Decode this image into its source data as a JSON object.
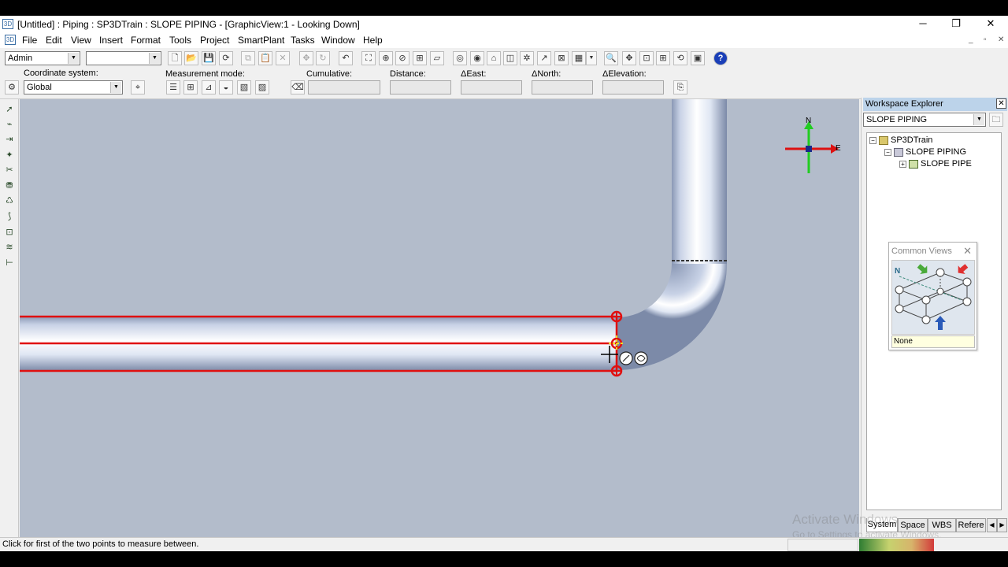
{
  "window": {
    "app_icon": "3D",
    "title": "[Untitled] : Piping : SP3DTrain : SLOPE PIPING - [GraphicView:1 - Looking Down]",
    "minimize": "─",
    "restore": "❐",
    "close": "✕"
  },
  "menu": {
    "doc_icon": "3D",
    "items": [
      "File",
      "Edit",
      "View",
      "Insert",
      "Format",
      "Tools",
      "Project",
      "SmartPlant",
      "Tasks",
      "Window",
      "Help"
    ],
    "mdi_min": "_",
    "mdi_restore": "▫",
    "mdi_close": "✕"
  },
  "toolbar1": {
    "permission_value": "Admin",
    "filter_value": ""
  },
  "measure_bar": {
    "coord_label": "Coordinate system:",
    "coord_value": "Global",
    "mode_label": "Measurement mode:",
    "cumulative_label": "Cumulative:",
    "distance_label": "Distance:",
    "east_label": "ΔEast:",
    "north_label": "ΔNorth:",
    "elevation_label": "ΔElevation:",
    "cumulative_value": "",
    "distance_value": "",
    "east_value": "",
    "north_value": "",
    "elevation_value": ""
  },
  "compass": {
    "north": "N",
    "east": "E",
    "colors": {
      "north": "#22cc22",
      "east": "#dd1111",
      "center": "#1a2a8a"
    }
  },
  "viewport": {
    "background": "#b3bccb",
    "pipe_highlight": "#e01010"
  },
  "workspace_explorer": {
    "title": "Workspace Explorer",
    "filter_value": "SLOPE PIPING",
    "tree": [
      {
        "label": "SP3DTrain",
        "level": 0,
        "expander": "−"
      },
      {
        "label": "SLOPE PIPING",
        "level": 1,
        "expander": "−"
      },
      {
        "label": "SLOPE PIPE",
        "level": 2,
        "expander": "+"
      }
    ],
    "tabs": [
      "System",
      "Space",
      "WBS",
      "Refere"
    ],
    "active_tab": "System"
  },
  "common_views": {
    "title": "Common Views",
    "close": "✕",
    "selection": "None",
    "axis_label": "N"
  },
  "status": {
    "message": "Click for first of the two points to measure between."
  },
  "watermark": {
    "line1": "Activate Windows",
    "line2": "Go to Settings to activate Windows."
  }
}
